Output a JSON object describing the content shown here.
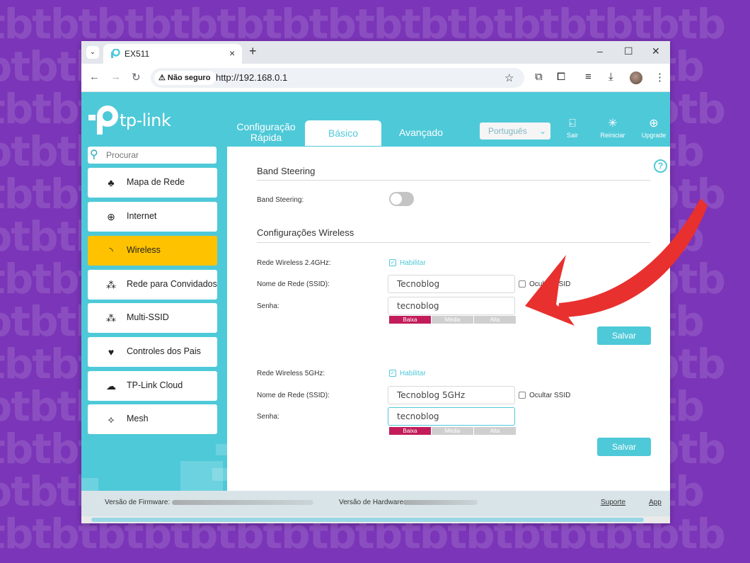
{
  "browser": {
    "tab_title": "EX511",
    "tab_close": "×",
    "new_tab": "+",
    "security_label": "Não seguro",
    "url": "http://192.168.0.1",
    "window_controls": [
      "–",
      "☐",
      "✕"
    ]
  },
  "brand": {
    "logo_text": "tp-link"
  },
  "top_nav": {
    "quick_setup": "Configuração Rápida",
    "basic": "Básico",
    "advanced": "Avançado",
    "language": "Português",
    "logout": "Sair",
    "reboot": "Reiniciar",
    "upgrade": "Upgrade"
  },
  "sidebar": {
    "search_placeholder": "Procurar",
    "items": [
      {
        "label": "Mapa de Rede",
        "icon": "network-map-icon"
      },
      {
        "label": "Internet",
        "icon": "globe-icon"
      },
      {
        "label": "Wireless",
        "icon": "wireless-icon",
        "active": true
      },
      {
        "label": "Rede para Convidados",
        "icon": "guest-network-icon"
      },
      {
        "label": "Multi-SSID",
        "icon": "multi-ssid-icon"
      },
      {
        "label": "Controles dos Pais",
        "icon": "parental-controls-icon"
      },
      {
        "label": "TP-Link Cloud",
        "icon": "cloud-icon"
      },
      {
        "label": "Mesh",
        "icon": "mesh-icon"
      }
    ]
  },
  "band_steering": {
    "section_title": "Band Steering",
    "label": "Band Steering:",
    "enabled": false
  },
  "wireless_settings": {
    "section_title": "Configurações Wireless",
    "band24": {
      "label": "Rede Wireless 2.4GHz:",
      "enable_label": "Habilitar",
      "enabled": true,
      "ssid_label": "Nome de Rede (SSID):",
      "ssid": "Tecnoblog",
      "hide_ssid_label": "Ocultar SSID",
      "password_label": "Senha:",
      "password": "tecnoblog",
      "strength": [
        "Baixa",
        "Média",
        "Alta"
      ],
      "save": "Salvar"
    },
    "band5": {
      "label": "Rede Wireless 5GHz:",
      "enable_label": "Habilitar",
      "enabled": true,
      "ssid_label": "Nome de Rede (SSID):",
      "ssid": "Tecnoblog 5GHz",
      "hide_ssid_label": "Ocultar SSID",
      "password_label": "Senha:",
      "password": "tecnoblog",
      "strength": [
        "Baixa",
        "Média",
        "Alta"
      ],
      "save": "Salvar"
    }
  },
  "footer": {
    "firmware_label": "Versão de Firmware:",
    "hardware_label": "Versão de Hardware:",
    "support": "Suporte",
    "app": "App"
  },
  "colors": {
    "accent": "#4ec9d8",
    "active_menu": "#ffc200",
    "weak_strength": "#c21d5a",
    "background": "#7b35b8",
    "annotation_arrow": "#e8302e"
  }
}
